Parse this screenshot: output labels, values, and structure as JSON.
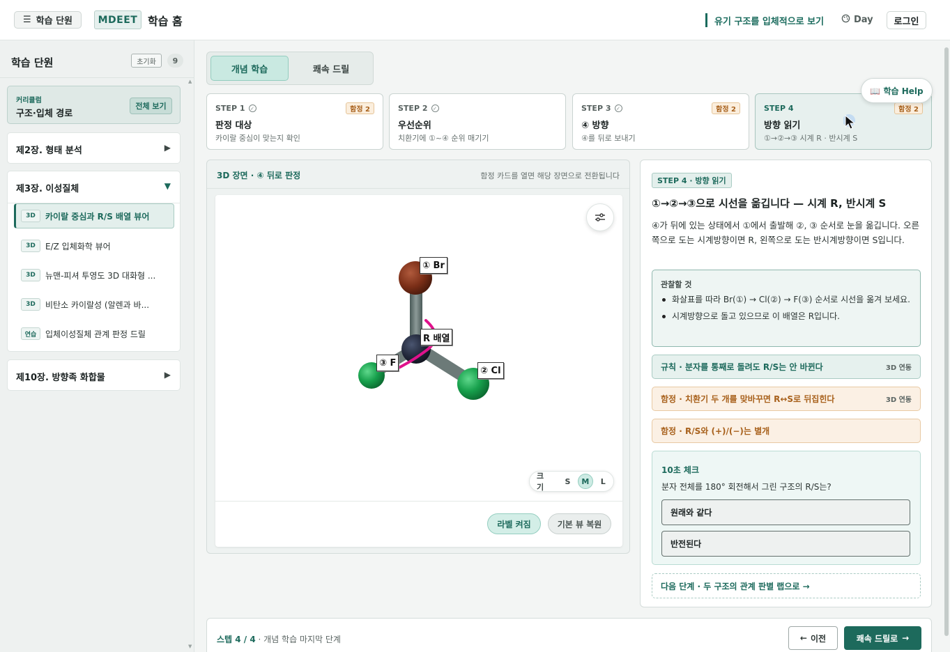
{
  "topbar": {
    "menu_label": "학습 단원",
    "logo": "MDEET",
    "home_title": "학습 홈",
    "tagline": "유기 구조를 입체적으로 보기",
    "theme_label": "Day",
    "login_label": "로그인"
  },
  "sidebar": {
    "title": "학습 단원",
    "reset_label": "초기화",
    "count": "9",
    "curriculum": {
      "kicker": "커리큘럼",
      "name": "구조·입체 경로",
      "view_all": "전체 보기"
    },
    "chapters": [
      {
        "title": "제2장. 형태 분석",
        "arrow": "▶"
      },
      {
        "title": "제3장. 이성질체",
        "arrow": "▼",
        "lessons": [
          {
            "badge": "3D",
            "label": "카이랄 중심과 R/S 배열 뷰어"
          },
          {
            "badge": "3D",
            "label": "E/Z 입체화학 뷰어"
          },
          {
            "badge": "3D",
            "label": "뉴맨-피셔 투영도 3D 대화형 ..."
          },
          {
            "badge": "3D",
            "label": "비탄소 카이랄성 (알렌과 바..."
          },
          {
            "badge": "연습",
            "label": "입체이성질체 관계 판정 드릴"
          }
        ]
      },
      {
        "title": "제10장. 방향족 화합물",
        "arrow": "▶"
      }
    ]
  },
  "tabs": [
    "개념 학습",
    "쾌속 드릴"
  ],
  "steps": [
    {
      "kicker": "STEP 1",
      "title": "판정 대상",
      "sub": "카이랄 중심이 맞는지 확인",
      "trap": "함정 2"
    },
    {
      "kicker": "STEP 2",
      "title": "우선순위",
      "sub": "치환기에 ①~④ 순위 매기기",
      "trap": ""
    },
    {
      "kicker": "STEP 3",
      "title": "④ 방향",
      "sub": "④를 뒤로 보내기",
      "trap": "함정 2"
    },
    {
      "kicker": "STEP 4",
      "title": "방향 읽기",
      "sub": "①→②→③ 시계 R · 반시계 S",
      "trap": "함정 2"
    }
  ],
  "help_label": "📖 학습 Help",
  "viewer": {
    "title": "3D 장면 · ④ 뒤로 판정",
    "hint": "함정 카드를 열면 해당 장면으로 전환됩니다",
    "atoms": {
      "br": "① Br",
      "cl": "② Cl",
      "f": "③ F",
      "center": "R 배열"
    },
    "size_label": "크기",
    "sizes": [
      "S",
      "M",
      "L"
    ],
    "size_selected": "M",
    "label_toggle": "라벨 켜짐",
    "reset_view": "기본 뷰 복원"
  },
  "panel": {
    "kicker": "STEP 4 · 방향 읽기",
    "title": "①→②→③으로 시선을 옮깁니다 — 시계 R, 반시계 S",
    "body": "④가 뒤에 있는 상태에서 ①에서 출발해 ②, ③ 순서로 눈을 옮깁니다. 오른쪽으로 도는 시계방향이면 R, 왼쪽으로 도는 반시계방향이면 S입니다.",
    "observe_head": "관찰할 것",
    "observe_items": [
      "화살표를 따라 Br(①) → Cl(②) → F(③) 순서로 시선을 옮겨 보세요.",
      "시계방향으로 돌고 있으므로 이 배열은 R입니다."
    ],
    "rules": [
      {
        "text": "규칙 · 분자를 통째로 돌려도 R/S는 안 바뀐다",
        "tag": "3D 연동"
      },
      {
        "text": "함정 · 치환기 두 개를 맞바꾸면 R↔S로 뒤집힌다",
        "tag": "3D 연동"
      },
      {
        "text": "함정 · R/S와 (+)/(−)는 별개",
        "tag": ""
      }
    ],
    "quiz": {
      "head": "10초 체크",
      "question": "분자 전체를 180° 회전해서 그린 구조의 R/S는?",
      "options": [
        "원래와 같다",
        "반전된다"
      ]
    },
    "next_link": "다음 단계 · 두 구조의 관계 판별 랩으로 →"
  },
  "footer": {
    "progress": "스텝 4 / 4",
    "progress_note": " · 개념 학습 마지막 단계",
    "prev_label": "이전",
    "next_label": "쾌속 드릴로"
  }
}
